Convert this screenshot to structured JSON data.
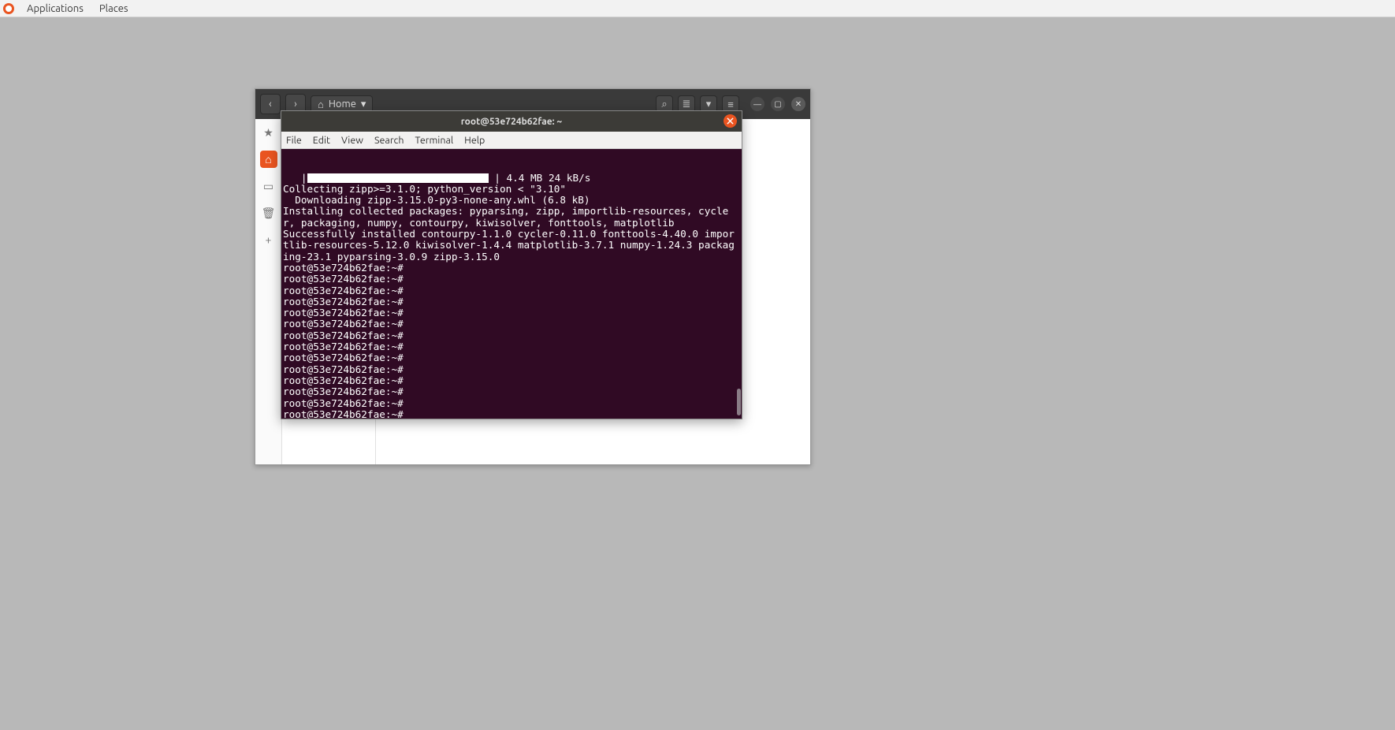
{
  "osbar": {
    "applications": "Applications",
    "places": "Places"
  },
  "files": {
    "home_label": "Home",
    "back_glyph": "‹",
    "fwd_glyph": "›",
    "dropdown_glyph": "▾",
    "search_glyph": "⌕",
    "list_glyph": "≣",
    "more_glyph": "≡",
    "min_glyph": "—",
    "max_glyph": "▢",
    "close_glyph": "✕",
    "home_icon": "⌂",
    "star_icon": "★",
    "rect_icon": "▭",
    "trash_icon": "🗑",
    "plus_icon": "+"
  },
  "term": {
    "title": "root@53e724b62fae: ~",
    "menus": [
      "File",
      "Edit",
      "View",
      "Search",
      "Terminal",
      "Help"
    ],
    "progress_suffix": "| 4.4 MB 24 kB/s",
    "lines_pre": [
      "   |"
    ],
    "lines_post": [
      "Collecting zipp>=3.1.0; python_version < \"3.10\"",
      "  Downloading zipp-3.15.0-py3-none-any.whl (6.8 kB)",
      "Installing collected packages: pyparsing, zipp, importlib-resources, cycler, packaging, numpy, contourpy, kiwisolver, fonttools, matplotlib",
      "Successfully installed contourpy-1.1.0 cycler-0.11.0 fonttools-4.40.0 importlib-resources-5.12.0 kiwisolver-1.4.4 matplotlib-3.7.1 numpy-1.24.3 packaging-23.1 pyparsing-3.0.9 zipp-3.15.0"
    ],
    "prompt": "root@53e724b62fae:~# ",
    "empty_prompt_count": 15
  }
}
